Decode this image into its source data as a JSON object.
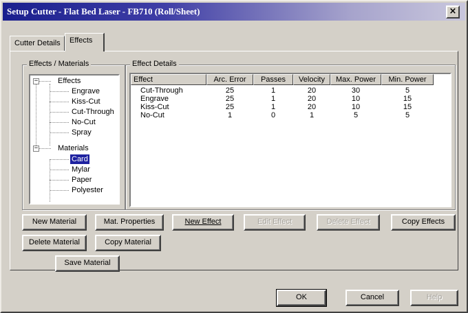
{
  "window": {
    "title": "Setup Cutter - Flat Bed Laser - FB710 (Roll/Sheet)",
    "close_glyph": "×"
  },
  "tabs": [
    {
      "label": "Cutter Details"
    },
    {
      "label": "Effects"
    }
  ],
  "effects_materials": {
    "label": "Effects / Materials",
    "tree": {
      "effects_root": "Effects",
      "effects": [
        "Engrave",
        "Kiss-Cut",
        "Cut-Through",
        "No-Cut",
        "Spray"
      ],
      "materials_root": "Materials",
      "materials": [
        "Card",
        "Mylar",
        "Paper",
        "Polyester"
      ],
      "selected": "Card",
      "expand_glyph_effects": "−",
      "expand_glyph_materials": "−"
    }
  },
  "effect_details": {
    "label": "Effect Details",
    "columns": [
      "Effect",
      "Arc. Error",
      "Passes",
      "Velocity",
      "Max. Power",
      "Min. Power"
    ],
    "rows": [
      [
        "Cut-Through",
        "25",
        "1",
        "20",
        "30",
        "5"
      ],
      [
        "Engrave",
        "25",
        "1",
        "20",
        "10",
        "15"
      ],
      [
        "Kiss-Cut",
        "25",
        "1",
        "20",
        "10",
        "15"
      ],
      [
        "No-Cut",
        "1",
        "0",
        "1",
        "5",
        "5"
      ]
    ]
  },
  "buttons": {
    "new_material": "New Material",
    "mat_properties": "Mat. Properties",
    "new_effect": "New Effect",
    "edit_effect": "Edit Effect",
    "delete_effect": "Delete Effect",
    "copy_effects": "Copy Effects",
    "delete_material": "Delete Material",
    "copy_material": "Copy Material",
    "save_material": "Save Material",
    "ok": "OK",
    "cancel": "Cancel",
    "help": "Help"
  },
  "colors": {
    "title_bar_start": "#1a1f8e",
    "title_bar_end": "#c9c7dd",
    "selection": "#1e22a0",
    "face": "#d4d0c8"
  }
}
